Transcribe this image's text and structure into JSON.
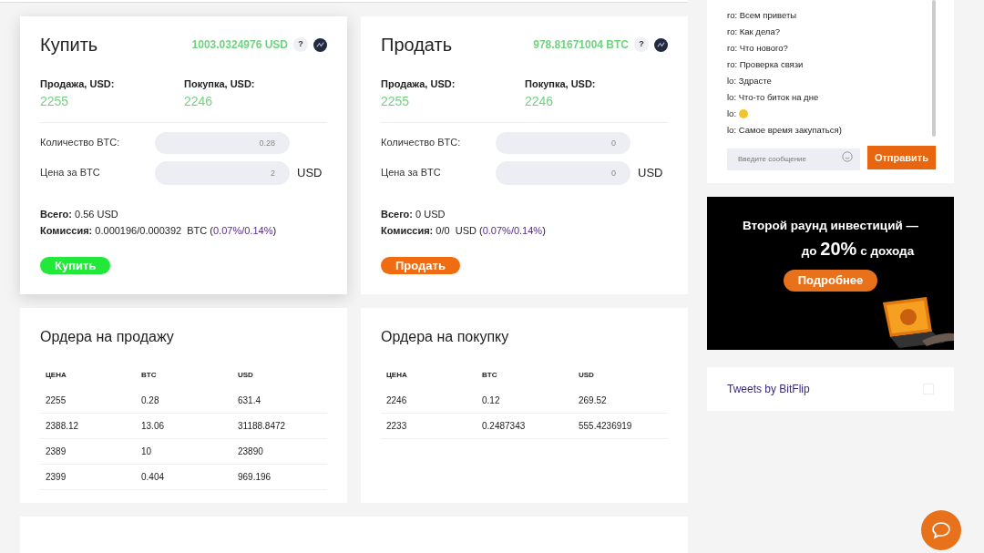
{
  "trade_cards": [
    {
      "kind": "buy",
      "title": "Купить",
      "balance": "1003.0324976 USD",
      "help": "?",
      "sell_label": "Продажа, USD:",
      "sell_price": "2255",
      "buy_label": "Покупка, USD:",
      "buy_price": "2246",
      "amount_label": "Количество BTC:",
      "amount_value": "0.28",
      "price_label": "Цена за BTC",
      "price_value": "2",
      "price_unit": "USD",
      "total": "**Всего:** 0.56 USD",
      "fee": "**Комиссия:** 0.000196/0.000392  BTC (",
      "fee_rate": "0.07%/0.14%",
      "fee_close": ")",
      "button": "Купить",
      "raised": true
    },
    {
      "kind": "sell",
      "title": "Продать",
      "balance": "978.81671004 BTC",
      "help": "?",
      "sell_label": "Продажа, USD:",
      "sell_price": "2255",
      "buy_label": "Покупка, USD:",
      "buy_price": "2246",
      "amount_label": "Количество BTC:",
      "amount_value": "0",
      "price_label": "Цена за BTC",
      "price_value": "0",
      "price_unit": "USD",
      "total": "**Всего:** 0 USD",
      "fee": "**Комиссия:** 0/0  USD (",
      "fee_rate": "0.07%/0.14%",
      "fee_close": ")",
      "button": "Продать",
      "raised": false
    }
  ],
  "order_books": [
    {
      "title": "Ордера на продажу",
      "columns": [
        "ЦЕНА",
        "BTC",
        "USD"
      ],
      "rows": [
        [
          "2255",
          "0.28",
          "631.4"
        ],
        [
          "2388.12",
          "13.06",
          "31188.8472"
        ],
        [
          "2389",
          "10",
          "23890"
        ],
        [
          "2399",
          "0.404",
          "969.196"
        ]
      ]
    },
    {
      "title": "Ордера на покупку",
      "columns": [
        "ЦЕНА",
        "BTC",
        "USD"
      ],
      "rows": [
        [
          "2246",
          "0.12",
          "269.52"
        ],
        [
          "2233",
          "0.2487343",
          "555.4236919"
        ]
      ]
    }
  ],
  "chat": {
    "messages": [
      {
        "kind": "text",
        "sender": "ro:",
        "text": "Всем приветы"
      },
      {
        "kind": "text",
        "sender": "ro:",
        "text": "Как дела?"
      },
      {
        "kind": "text",
        "sender": "ro:",
        "text": "Что нового?"
      },
      {
        "kind": "text",
        "sender": "ro:",
        "text": "Проверка связи"
      },
      {
        "kind": "text",
        "sender": "lo:",
        "text": "Здрасте"
      },
      {
        "kind": "text",
        "sender": "lo:",
        "text": "Что-то биток на дне"
      },
      {
        "kind": "emoji",
        "sender": "lo:"
      },
      {
        "kind": "text",
        "sender": "lo:",
        "text": "Самое время закупаться)"
      }
    ],
    "input": {
      "placeholder": "Введите сообщение"
    },
    "send_button": "Отправить"
  },
  "banner": {
    "headline": "Второй раунд инвестиций —",
    "subline_start": "до ",
    "subline_big": "20%",
    "subline_end": " с дохода",
    "button": "Подробнее"
  },
  "tweets": {
    "link": "Tweets by BitFlip"
  }
}
